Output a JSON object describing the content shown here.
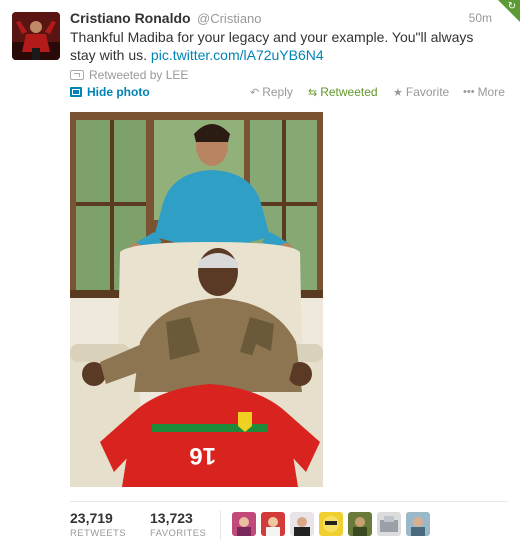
{
  "tweet": {
    "fullname": "Cristiano Ronaldo",
    "username": "@Cristiano",
    "time": "50m",
    "text": "Thankful Madiba for your legacy and your example. You\"ll always stay with us. ",
    "link": "pic.twitter.com/lA72uYB6N4",
    "retweeted_by": "Retweeted by LEE",
    "hide_photo": "Hide photo",
    "actions": {
      "reply": "Reply",
      "retweeted": "Retweeted",
      "favorite": "Favorite",
      "more": "More"
    }
  },
  "stats": {
    "retweets_count": "23,719",
    "retweets_label": "RETWEETS",
    "favorites_count": "13,723",
    "favorites_label": "FAVORITES"
  },
  "colors": {
    "link": "#0084b4",
    "retweeted": "#609928",
    "muted": "#999999",
    "corner": "#5b9a34"
  },
  "icons": {
    "reply": "reply-arrow-icon",
    "retweet": "retweet-icon",
    "favorite": "star-icon",
    "more": "ellipsis-icon",
    "photo": "photo-icon"
  }
}
